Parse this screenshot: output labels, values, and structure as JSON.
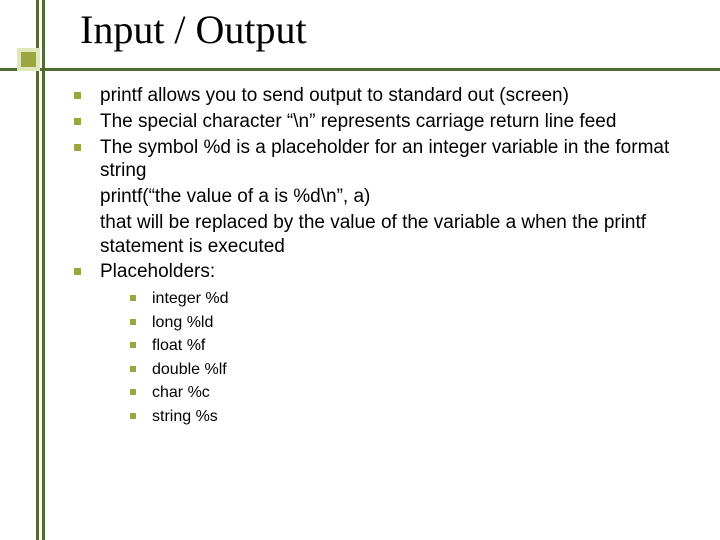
{
  "title": "Input / Output",
  "bullets": [
    {
      "text": "printf allows you to send output to standard out (screen)"
    },
    {
      "text": "The special character “\\n” represents carriage return line feed"
    },
    {
      "text": "The symbol %d is a placeholder for an integer variable in the format string",
      "cont": [
        "printf(“the value of a is %d\\n”, a)",
        "that will be replaced by the value of the variable a when the printf statement is executed"
      ]
    },
    {
      "text": "Placeholders:",
      "sub": [
        "integer %d",
        "long %ld",
        "float %f",
        "double %lf",
        "char %c",
        "string %s"
      ]
    }
  ]
}
